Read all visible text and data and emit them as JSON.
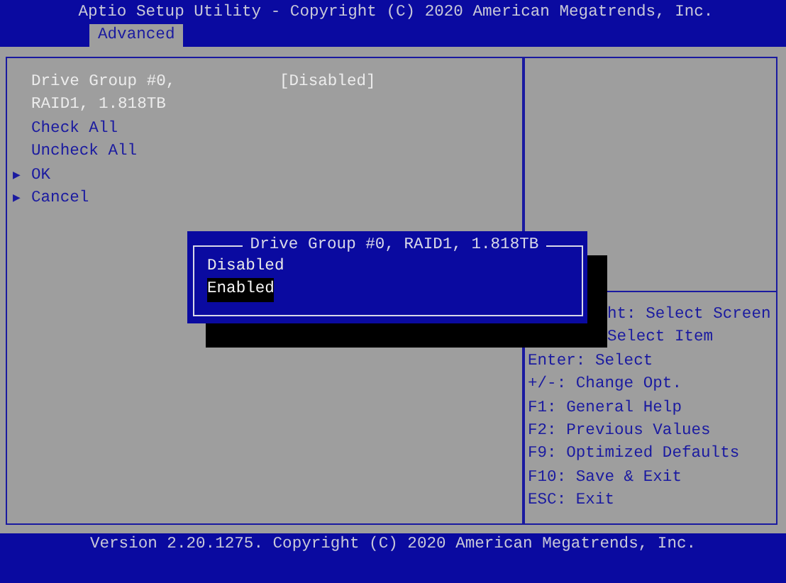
{
  "title": "Aptio Setup Utility - Copyright (C) 2020 American Megatrends, Inc.",
  "tabs": [
    {
      "label": "Advanced",
      "selected": true
    }
  ],
  "settings": [
    {
      "kind": "option",
      "label": "Drive Group #0,",
      "label_line_2": "RAID1, 1.818TB",
      "value": "[Disabled]"
    },
    {
      "kind": "action",
      "label": "Check All"
    },
    {
      "kind": "action",
      "label": "Uncheck All"
    },
    {
      "kind": "submenu",
      "marker": "▶",
      "label": "OK"
    },
    {
      "kind": "submenu",
      "marker": "▶",
      "label": "Cancel"
    }
  ],
  "popup": {
    "title": "Drive Group #0, RAID1, 1.818TB",
    "options": [
      {
        "label": "Disabled",
        "selected": false
      },
      {
        "label": "Enabled",
        "selected": true
      }
    ]
  },
  "help": [
    {
      "text": "ht: Select Screen",
      "covered": true
    },
    {
      "text": "Select Item",
      "covered": true
    },
    {
      "text": "Enter: Select",
      "covered": false
    },
    {
      "text": "+/-: Change Opt.",
      "covered": false
    },
    {
      "text": "F1: General Help",
      "covered": false
    },
    {
      "text": "F2: Previous Values",
      "covered": false
    },
    {
      "text": "F9: Optimized Defaults",
      "covered": false
    },
    {
      "text": "F10: Save & Exit",
      "covered": false
    },
    {
      "text": "ESC: Exit",
      "covered": false
    }
  ],
  "footer": "Version 2.20.1275. Copyright (C) 2020 American Megatrends, Inc."
}
